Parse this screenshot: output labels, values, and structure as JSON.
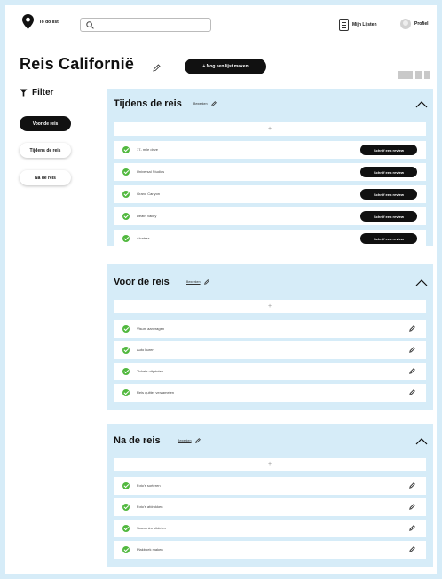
{
  "header": {
    "logo_text": "To do list",
    "search_placeholder": "",
    "my_lists_label": "Mijn Lijsten",
    "profile_label": "Profiel"
  },
  "page": {
    "title": "Reis Californië",
    "new_list_button": "+ Nog een lijst maken"
  },
  "filter": {
    "heading": "Filter",
    "options": [
      {
        "label": "Voor de reis",
        "active": true
      },
      {
        "label": "Tijdens de reis",
        "active": false
      },
      {
        "label": "Na de reis",
        "active": false
      }
    ]
  },
  "lists": [
    {
      "title": "Tijdens de reis",
      "edit_label": "Bewerken",
      "add_label": "+",
      "item_action": "Schrijf een review",
      "items": [
        "17- mile drive",
        "Universal Studios",
        "Grand Canyon",
        "Death Valley",
        "Alcatraz"
      ]
    },
    {
      "title": "Voor de reis",
      "edit_label": "Bewerken",
      "add_label": "+",
      "items": [
        "Visum aanvragen",
        "Auto huren",
        "Tickets uitprinten",
        "Reis quitter verzamelen"
      ]
    },
    {
      "title": "Na de reis",
      "edit_label": "Bewerken",
      "add_label": "+",
      "items": [
        "Foto's sorteren",
        "Foto's afdrukken",
        "Souvenirs uitdelen",
        "Plakboek maken"
      ]
    }
  ],
  "colors": {
    "background": "#d6ecf8",
    "card": "#d6ecf8",
    "check": "#51b83e",
    "button": "#111111"
  },
  "icons": {
    "logo": "map-pin-icon",
    "search": "search-icon",
    "lists": "document-list-icon",
    "profile": "avatar-icon",
    "edit": "pencil-icon",
    "collapse": "chevron-up-icon",
    "filter": "funnel-icon",
    "done": "check-circle-icon"
  }
}
